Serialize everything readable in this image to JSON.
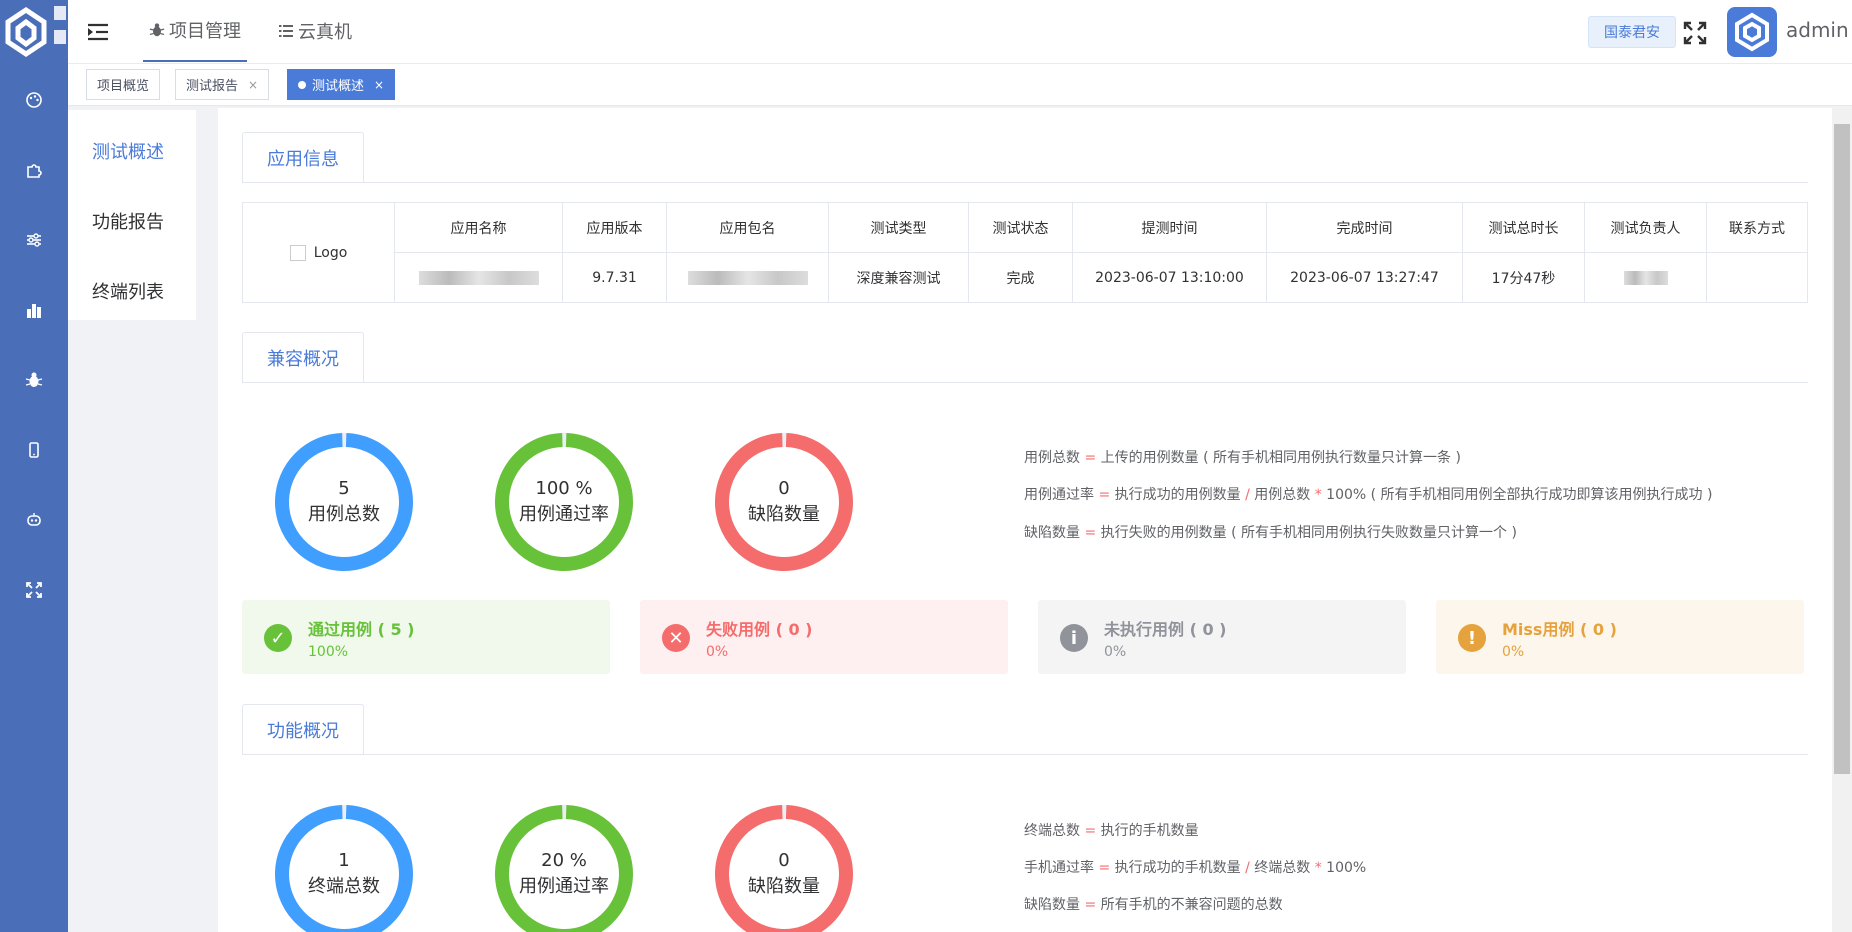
{
  "topnav": {
    "items": [
      {
        "label": "项目管理",
        "icon": "bug-icon"
      },
      {
        "label": "云真机",
        "icon": "list-icon"
      }
    ],
    "company": "国泰君安",
    "user": "admin"
  },
  "sidebar_icons": [
    "palette-icon",
    "puzzle-icon",
    "sliders-icon",
    "bar-chart-icon",
    "bug-icon",
    "phone-icon",
    "robot-icon",
    "expand-icon"
  ],
  "tabs": [
    {
      "label": "项目概览",
      "closable": false,
      "active": false
    },
    {
      "label": "测试报告",
      "closable": true,
      "active": false
    },
    {
      "label": "测试概述",
      "closable": true,
      "active": true
    }
  ],
  "submenu": {
    "items": [
      "测试概述",
      "功能报告",
      "终端列表"
    ],
    "active": "测试概述"
  },
  "app_info": {
    "section_title": "应用信息",
    "logo_alt": "Logo",
    "headers": [
      "应用名称",
      "应用版本",
      "应用包名",
      "测试类型",
      "测试状态",
      "提测时间",
      "完成时间",
      "测试总时长",
      "测试负责人",
      "联系方式"
    ],
    "row": {
      "version": "9.7.31",
      "test_type": "深度兼容测试",
      "status": "完成",
      "submit_time": "2023-06-07 13:10:00",
      "finish_time": "2023-06-07 13:27:47",
      "duration": "17分47秒"
    }
  },
  "compat": {
    "section_title": "兼容概况",
    "rings": [
      {
        "value": "5",
        "label": "用例总数",
        "color": "#409eff",
        "fill": 1.0
      },
      {
        "value": "100 %",
        "label": "用例通过率",
        "color": "#67c23a",
        "fill": 1.0
      },
      {
        "value": "0",
        "label": "缺陷数量",
        "color": "#f56c6c",
        "fill": 1.0
      }
    ],
    "formulas": [
      {
        "term": "用例总数",
        "op1": "=",
        "rhs": "上传的用例数量 ( 所有手机相同用例执行数量只计算一条 )"
      },
      {
        "term": "用例通过率",
        "op1": "=",
        "rhs": "执行成功的用例数量",
        "op2": "/",
        "rhs2": "用例总数",
        "op3": "*",
        "rhs3": "100% ( 所有手机相同用例全部执行成功即算该用例执行成功 )"
      },
      {
        "term": "缺陷数量",
        "op1": "=",
        "rhs": "执行失败的用例数量 ( 所有手机相同用例执行失败数量只计算一个 )"
      }
    ],
    "stats": [
      {
        "title": "通过用例 ( 5 )",
        "pct": "100%",
        "bg": "#f0f9eb",
        "color": "#67c23a",
        "icon": "check-icon",
        "glyph": "✓"
      },
      {
        "title": "失败用例 ( 0 )",
        "pct": "0%",
        "bg": "#fef0f0",
        "color": "#f56c6c",
        "icon": "x-icon",
        "glyph": "✕"
      },
      {
        "title": "未执行用例 ( 0 )",
        "pct": "0%",
        "bg": "#f4f4f5",
        "color": "#909399",
        "icon": "info-icon",
        "glyph": "i"
      },
      {
        "title": "Miss用例 ( 0 )",
        "pct": "0%",
        "bg": "#fdf6ec",
        "color": "#e6a23c",
        "icon": "warning-icon",
        "glyph": "!"
      }
    ]
  },
  "func": {
    "section_title": "功能概况",
    "rings": [
      {
        "value": "1",
        "label": "终端总数",
        "color": "#409eff",
        "fill": 1.0
      },
      {
        "value": "20 %",
        "label": "用例通过率",
        "color": "#67c23a",
        "fill": 1.0
      },
      {
        "value": "0",
        "label": "缺陷数量",
        "color": "#f56c6c",
        "fill": 1.0
      }
    ],
    "formulas": [
      {
        "term": "终端总数",
        "op1": "=",
        "rhs": "执行的手机数量"
      },
      {
        "term": "手机通过率",
        "op1": "=",
        "rhs": "执行成功的手机数量",
        "op2": "/",
        "rhs2": "终端总数",
        "op3": "*",
        "rhs3": "100%"
      },
      {
        "term": "缺陷数量",
        "op1": "=",
        "rhs": "所有手机的不兼容问题的总数"
      }
    ]
  }
}
